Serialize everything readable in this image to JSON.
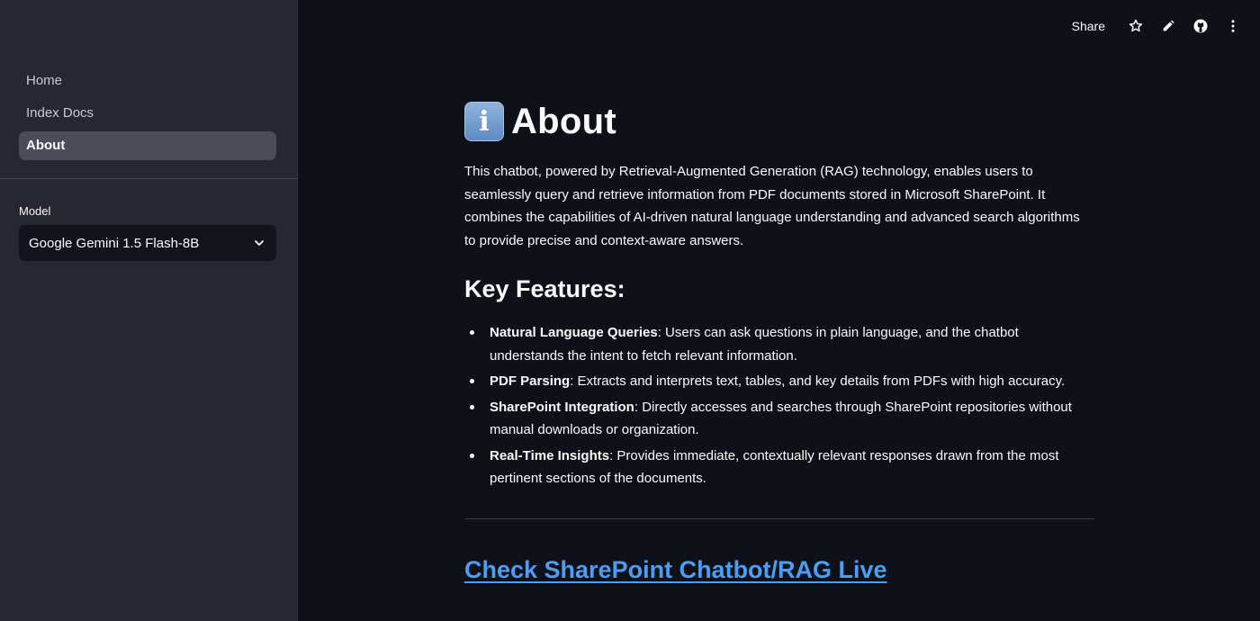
{
  "sidebar": {
    "nav": [
      {
        "label": "Home",
        "active": false
      },
      {
        "label": "Index Docs",
        "active": false
      },
      {
        "label": "About",
        "active": true
      }
    ],
    "model_label": "Model",
    "model_value": "Google Gemini 1.5 Flash-8B"
  },
  "toolbar": {
    "share_label": "Share",
    "icons": [
      "star-icon",
      "pencil-icon",
      "github-icon",
      "more-vertical-icon"
    ]
  },
  "main": {
    "title_icon": "i",
    "title": "About",
    "intro": "This chatbot, powered by Retrieval-Augmented Generation (RAG) technology, enables users to seamlessly query and retrieve information from PDF documents stored in Microsoft SharePoint. It combines the capabilities of AI-driven natural language understanding and advanced search algorithms to provide precise and context-aware answers.",
    "features_heading": "Key Features:",
    "features": [
      {
        "name": "Natural Language Queries",
        "text": ": Users can ask questions in plain language, and the chatbot understands the intent to fetch relevant information."
      },
      {
        "name": "PDF Parsing",
        "text": ": Extracts and interprets text, tables, and key details from PDFs with high accuracy."
      },
      {
        "name": "SharePoint Integration",
        "text": ": Directly accesses and searches through SharePoint repositories without manual downloads or organization."
      },
      {
        "name": "Real-Time Insights",
        "text": ": Provides immediate, contextually relevant responses drawn from the most pertinent sections of the documents."
      }
    ],
    "link_label": "Check SharePoint Chatbot/RAG Live"
  },
  "colors": {
    "sidebar_bg": "#262730",
    "main_bg": "#0e1117",
    "link": "#4d9df5",
    "active_nav_bg": "#4a4c57"
  }
}
